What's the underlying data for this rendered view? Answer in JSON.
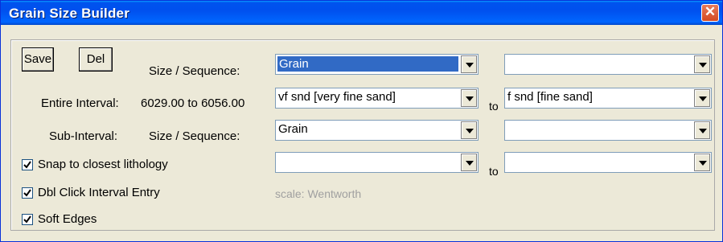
{
  "window": {
    "title": "Grain Size Builder",
    "close_icon": "close-icon"
  },
  "buttons": {
    "save": "Save",
    "del": "Del"
  },
  "labels": {
    "size_sequence": "Size / Sequence:",
    "entire_interval": "Entire Interval:",
    "entire_interval_value": "6029.00 to 6056.00",
    "sub_interval": "Sub-Interval:",
    "sub_size_sequence": "Size / Sequence:",
    "scale": "scale: Wentworth",
    "to": "to"
  },
  "combos": {
    "size_sequence_1": "Grain",
    "size_sequence_2": "",
    "entire_from": "vf snd  [very fine sand]",
    "entire_to": "f snd  [fine sand]",
    "sub_size_sequence_1": "Grain",
    "sub_size_sequence_2": "",
    "sub_from": "",
    "sub_to": ""
  },
  "checkboxes": [
    {
      "label": "Snap to closest lithology",
      "checked": true
    },
    {
      "label": "Dbl Click Interval Entry",
      "checked": true
    },
    {
      "label": "Soft Edges",
      "checked": true
    }
  ],
  "colors": {
    "titlebar": "#0053ee",
    "selection": "#316ac5",
    "close": "#d54a22"
  }
}
